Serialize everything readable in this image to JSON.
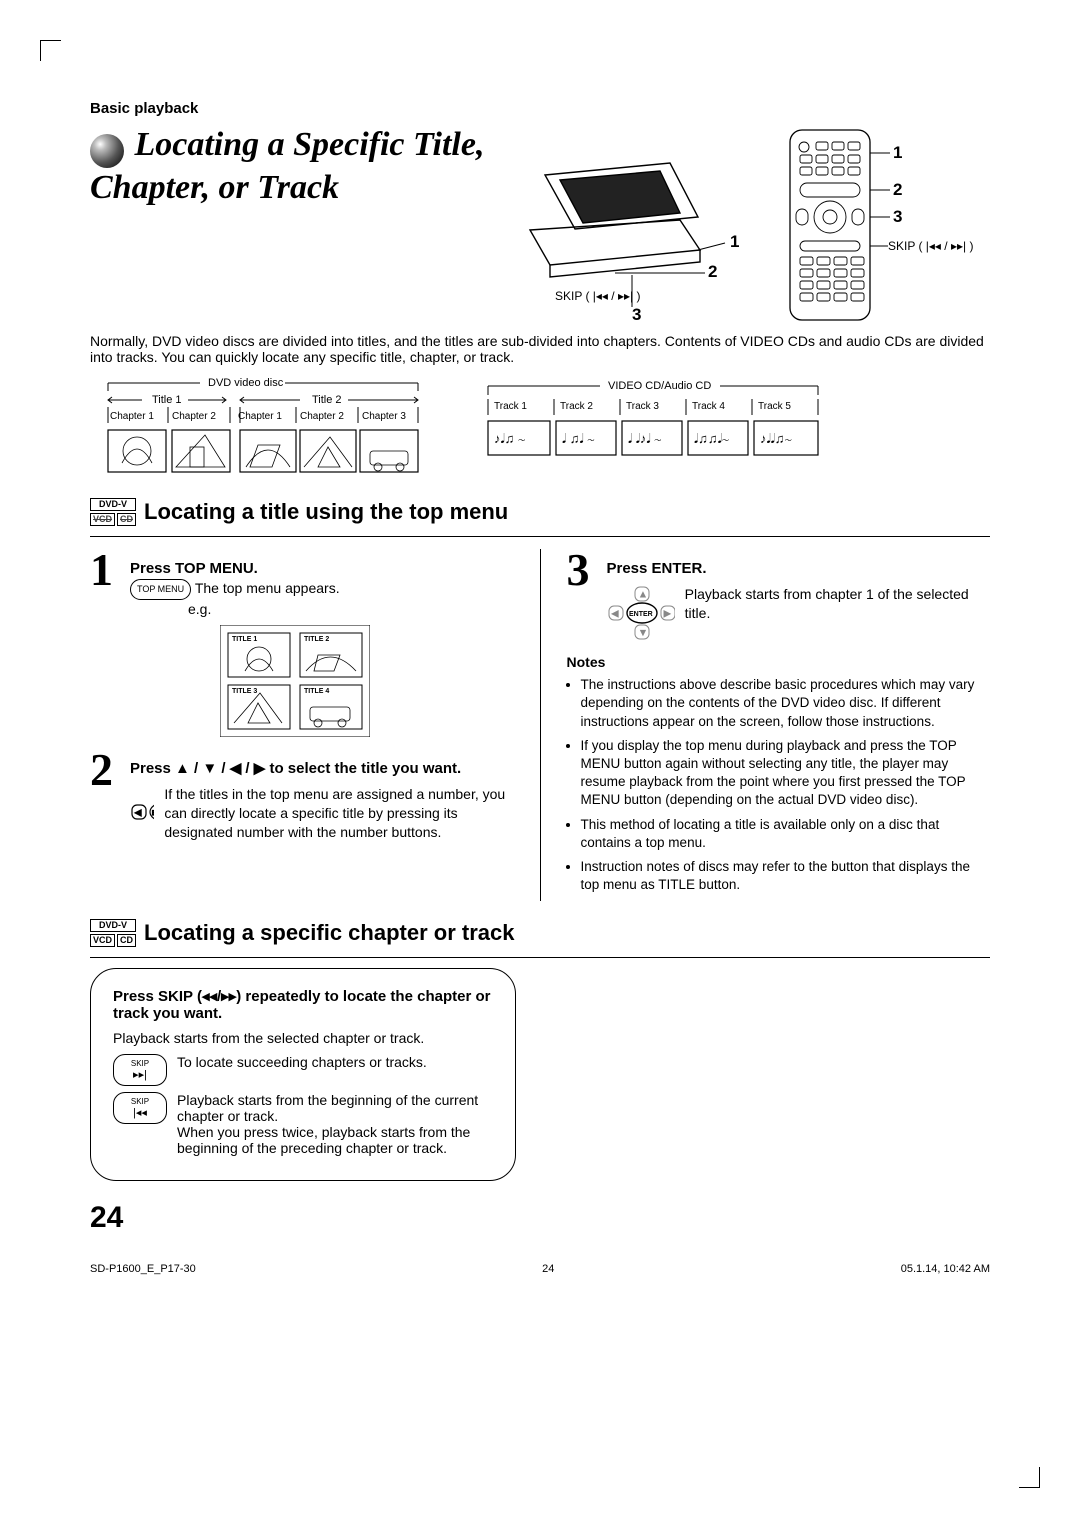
{
  "section_label": "Basic playback",
  "main_title": "Locating a Specific Title, Chapter, or Track",
  "player_callouts": {
    "c1": "1",
    "c2": "2",
    "c3": "3",
    "skip": "SKIP (",
    "skip_icons": "◂◂ / ▸▸",
    ")": ")"
  },
  "remote_callouts": {
    "c1": "1",
    "c2": "2",
    "c3": "3",
    "skip": "SKIP (",
    "skip_icons": "◂◂ / ▸▸"
  },
  "intro": "Normally, DVD video discs are divided into titles, and the titles are sub-divided into chapters. Contents of VIDEO CDs and audio CDs are divided into tracks. You can quickly locate any specific title, chapter, or track.",
  "dvd_diag": {
    "label": "DVD video disc",
    "title1": "Title 1",
    "title2": "Title 2",
    "ch": [
      "Chapter 1",
      "Chapter 2",
      "Chapter 1",
      "Chapter 2",
      "Chapter 3"
    ]
  },
  "cd_diag": {
    "label": "VIDEO CD/Audio CD",
    "tracks": [
      "Track 1",
      "Track 2",
      "Track 3",
      "Track 4",
      "Track 5"
    ]
  },
  "tags": {
    "dvdv": "DVD-V",
    "vcd": "VCD",
    "cd": "CD"
  },
  "sub1": "Locating a title using the top menu",
  "step1": {
    "num": "1",
    "head": "Press TOP MENU.",
    "btn": "TOP MENU",
    "line": "The top menu appears.",
    "eg": "e.g.",
    "tiles": [
      "TITLE 1",
      "TITLE 2",
      "TITLE 3",
      "TITLE 4"
    ]
  },
  "step2": {
    "num": "2",
    "head": "Press ▲ / ▼ / ◀ / ▶ to select the title you want.",
    "body": "If the titles in the top menu are assigned a number, you can directly locate a specific title by pressing its designated number with the number buttons."
  },
  "step3": {
    "num": "3",
    "head": "Press ENTER.",
    "body": "Playback starts from chapter 1 of the selected title.",
    "enter": "ENTER"
  },
  "notes_title": "Notes",
  "notes": [
    "The instructions above describe basic procedures which may vary depending on the contents of the DVD video disc. If different instructions appear on the screen, follow those instructions.",
    "If you display the top menu during playback and press the TOP MENU button again without selecting any title, the player may resume playback from the point where you first pressed the TOP MENU button (depending on the actual DVD video disc).",
    "This method of locating a title is available only on a disc that contains a top menu.",
    "Instruction notes of discs may refer to the button that displays the top menu as TITLE button."
  ],
  "sub2": "Locating a specific chapter or track",
  "skip": {
    "head": "Press SKIP (◂◂/▸▸) repeatedly to locate the chapter or track you want.",
    "line": "Playback starts from the selected chapter or track.",
    "fwd_label": "SKIP",
    "fwd_sym": "▸▸|",
    "fwd_text": "To locate succeeding chapters or tracks.",
    "back_label": "SKIP",
    "back_sym": "|◂◂",
    "back_text1": "Playback starts from the beginning of the current chapter or track.",
    "back_text2": "When you press twice, playback starts from the beginning of the preceding chapter or track."
  },
  "page_number": "24",
  "footer": {
    "file": "SD-P1600_E_P17-30",
    "pg": "24",
    "stamp": "05.1.14, 10:42 AM"
  }
}
